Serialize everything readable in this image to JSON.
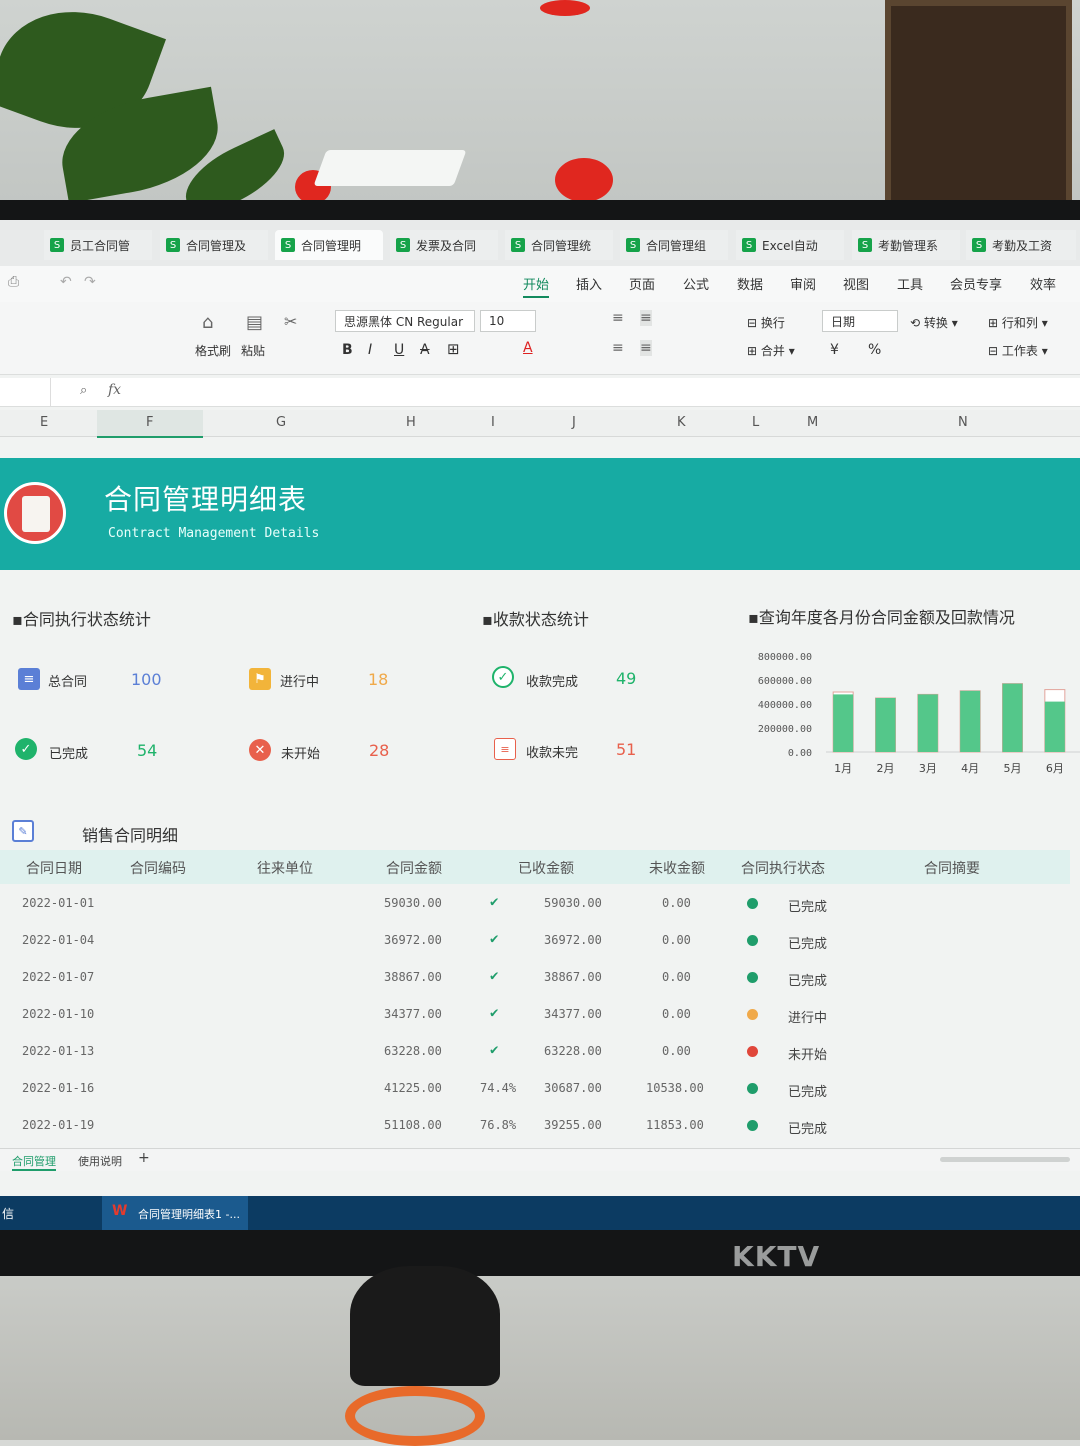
{
  "tabs": [
    {
      "label": "员工合同管"
    },
    {
      "label": "合同管理及"
    },
    {
      "label": "合同管理明"
    },
    {
      "label": "发票及合同"
    },
    {
      "label": "合同管理统"
    },
    {
      "label": "合同管理组"
    },
    {
      "label": "Excel自动"
    },
    {
      "label": "考勤管理系"
    },
    {
      "label": "考勤及工资"
    }
  ],
  "menu": [
    "开始",
    "插入",
    "页面",
    "公式",
    "数据",
    "审阅",
    "视图",
    "工具",
    "会员专享",
    "效率"
  ],
  "ribbon": {
    "format_painter": "格式刷",
    "paste": "粘贴",
    "font": "思源黑体 CN Regular",
    "font_size": "10",
    "wrap": "换行",
    "merge": "合并",
    "number_format": "日期",
    "convert": "转换",
    "rows_cols": "行和列",
    "worksheet": "工作表",
    "currency": "¥",
    "percent": "%"
  },
  "formula": {
    "fx": "fx"
  },
  "columns": [
    "E",
    "F",
    "G",
    "H",
    "I",
    "J",
    "K",
    "L",
    "M",
    "N"
  ],
  "header": {
    "title": "合同管理明细表",
    "subtitle": "Contract Management Details"
  },
  "sections": {
    "exec": "▪合同执行状态统计",
    "payment": "▪收款状态统计",
    "chart": "▪查询年度各月份合同金额及回款情况",
    "detail": "销售合同明细"
  },
  "stats": {
    "total": {
      "label": "总合同",
      "value": "100"
    },
    "in_progress": {
      "label": "进行中",
      "value": "18"
    },
    "done": {
      "label": "已完成",
      "value": "54"
    },
    "not_started": {
      "label": "未开始",
      "value": "28"
    },
    "paid": {
      "label": "收款完成",
      "value": "49"
    },
    "unpaid": {
      "label": "收款未完",
      "value": "51"
    }
  },
  "chart_data": {
    "type": "bar",
    "categories": [
      "1月",
      "2月",
      "3月",
      "4月",
      "5月",
      "6月"
    ],
    "series": [
      {
        "values": [
          500000,
          450000,
          480000,
          510000,
          570000,
          520000
        ]
      },
      {
        "values": [
          480000,
          450000,
          480000,
          510000,
          570000,
          420000
        ]
      }
    ],
    "yticks": [
      "800000.00",
      "600000.00",
      "400000.00",
      "200000.00",
      "0.00"
    ],
    "ylim": [
      0,
      800000
    ],
    "colors": [
      "#e2a49c",
      "#54c78a"
    ]
  },
  "table": {
    "headers": [
      "合同日期",
      "合同编码",
      "往来单位",
      "合同金额",
      "已收金额",
      "未收金额",
      "合同执行状态",
      "合同摘要"
    ],
    "rows": [
      {
        "date": "2022-01-01",
        "amount": "59030.00",
        "ratio": "✔",
        "received": "59030.00",
        "unpaid": "0.00",
        "status": "已完成",
        "state": "done"
      },
      {
        "date": "2022-01-04",
        "amount": "36972.00",
        "ratio": "✔",
        "received": "36972.00",
        "unpaid": "0.00",
        "status": "已完成",
        "state": "done"
      },
      {
        "date": "2022-01-07",
        "amount": "38867.00",
        "ratio": "✔",
        "received": "38867.00",
        "unpaid": "0.00",
        "status": "已完成",
        "state": "done"
      },
      {
        "date": "2022-01-10",
        "amount": "34377.00",
        "ratio": "✔",
        "received": "34377.00",
        "unpaid": "0.00",
        "status": "进行中",
        "state": "progress"
      },
      {
        "date": "2022-01-13",
        "amount": "63228.00",
        "ratio": "✔",
        "received": "63228.00",
        "unpaid": "0.00",
        "status": "未开始",
        "state": "notstarted"
      },
      {
        "date": "2022-01-16",
        "amount": "41225.00",
        "ratio": "74.4%",
        "received": "30687.00",
        "unpaid": "10538.00",
        "status": "已完成",
        "state": "done"
      },
      {
        "date": "2022-01-19",
        "amount": "51108.00",
        "ratio": "76.8%",
        "received": "39255.00",
        "unpaid": "11853.00",
        "status": "已完成",
        "state": "done"
      }
    ]
  },
  "sheets": [
    "合同管理",
    "使用说明",
    "+"
  ],
  "taskbar": {
    "left": "信",
    "app": "合同管理明细表1 -..."
  },
  "brand": "KKTV",
  "colors": {
    "teal": "#17aba3",
    "done": "#1f9d6b",
    "progress": "#f0a94a",
    "notstarted": "#e0463a"
  }
}
